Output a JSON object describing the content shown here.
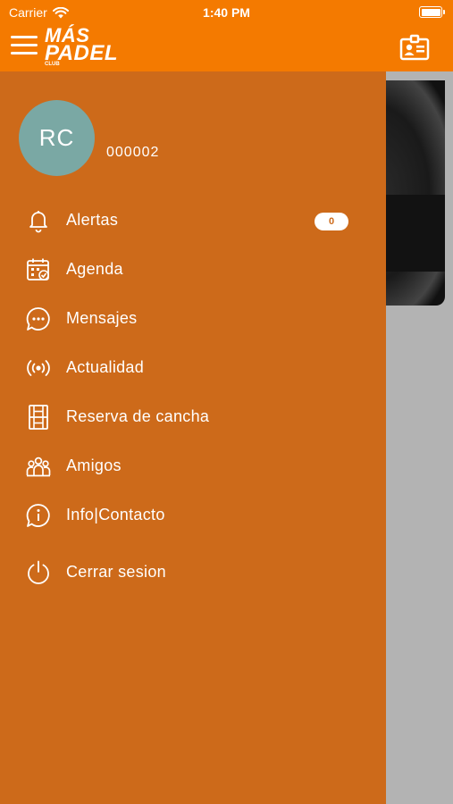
{
  "status_bar": {
    "carrier": "Carrier",
    "time": "1:40 PM",
    "wifi_icon": "wifi-icon",
    "battery_icon": "battery-icon"
  },
  "nav_bar": {
    "logo": {
      "line1": "MÁS",
      "line2": "PADEL",
      "line3": "CLUB"
    },
    "menu_icon": "hamburger-icon",
    "card_icon": "id-card-icon"
  },
  "profile": {
    "initials": "RC",
    "user_id": "000002"
  },
  "menu": {
    "alertas": {
      "label": "Alertas",
      "icon": "bell-icon",
      "badge": "0"
    },
    "agenda": {
      "label": "Agenda",
      "icon": "calendar-check-icon"
    },
    "mensajes": {
      "label": "Mensajes",
      "icon": "chat-bubble-icon"
    },
    "actualidad": {
      "label": "Actualidad",
      "icon": "broadcast-icon"
    },
    "reserva": {
      "label": "Reserva de cancha",
      "icon": "court-icon"
    },
    "amigos": {
      "label": "Amigos",
      "icon": "group-icon"
    },
    "info": {
      "label": "Info|Contacto",
      "icon": "info-bubble-icon"
    },
    "cerrar": {
      "label": "Cerrar sesion",
      "icon": "power-icon"
    }
  },
  "colors": {
    "brand": "#f47a00",
    "drawer": "#cd6a1a",
    "avatar": "#7aa8a4",
    "backdrop": "#b3b3b3"
  }
}
